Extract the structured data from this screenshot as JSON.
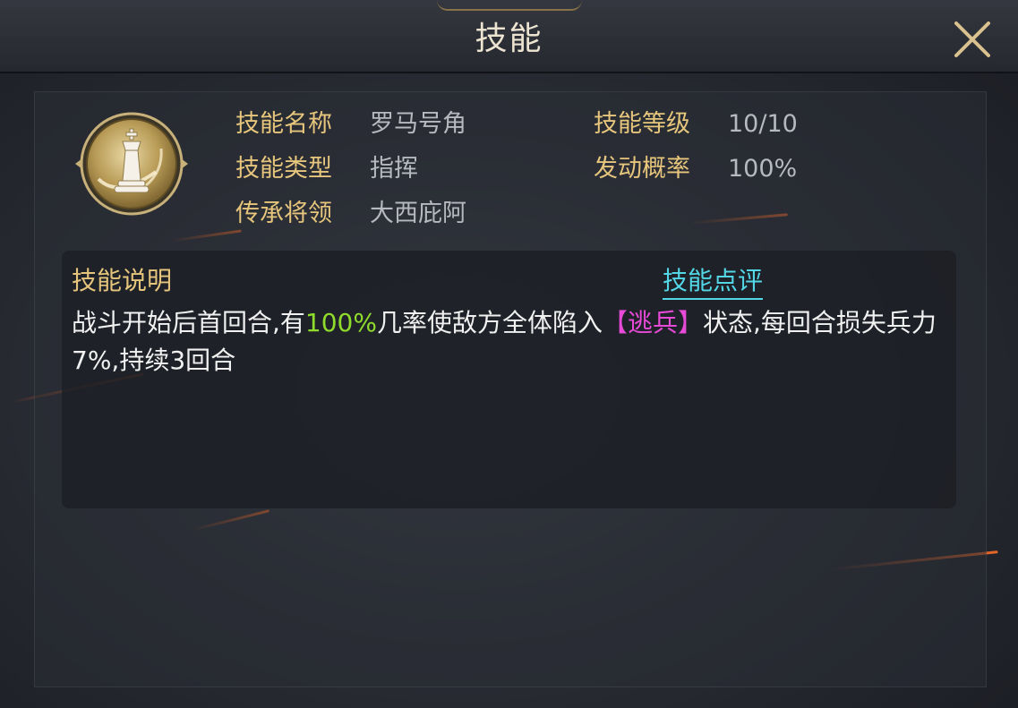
{
  "window": {
    "title": "技能"
  },
  "skill": {
    "icon": "chess-king-icon",
    "rows": [
      {
        "label": "技能名称",
        "value": "罗马号角"
      },
      {
        "label": "技能类型",
        "value": "指挥"
      },
      {
        "label": "传承将领",
        "value": "大西庇阿"
      },
      {
        "label": "技能等级",
        "value": "10/10"
      },
      {
        "label": "发动概率",
        "value": "100%"
      }
    ]
  },
  "description": {
    "title": "技能说明",
    "review_link": "技能点评",
    "segments": [
      {
        "text": "战斗开始后首回合,有",
        "color": "#f1f1f1"
      },
      {
        "text": "100%",
        "color": "#8fdc2c"
      },
      {
        "text": "几率使敌方全体陷入",
        "color": "#f1f1f1"
      },
      {
        "text": "【逃兵】",
        "color": "#e64ad6"
      },
      {
        "text": "状态,每回合损失兵力7%,持续3回合",
        "color": "#f1f1f1"
      }
    ]
  },
  "colors": {
    "label_gold": "#e6c57c",
    "value_gray": "#b6b9c0",
    "link_cyan": "#53d7e7",
    "highlight_green": "#8fdc2c",
    "highlight_magenta": "#e64ad6"
  }
}
